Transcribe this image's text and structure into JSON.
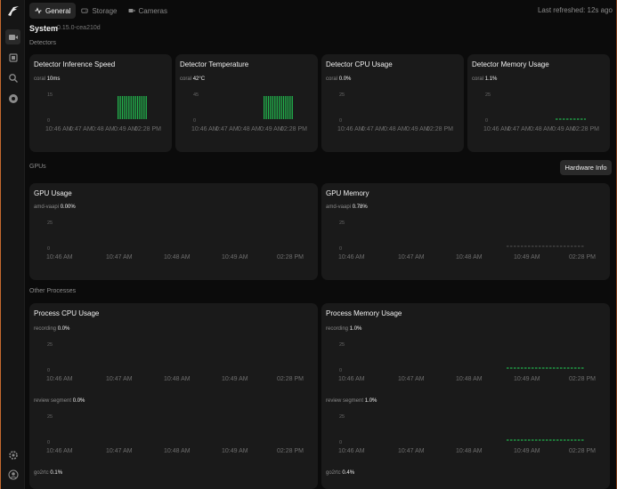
{
  "tabs": [
    {
      "label": "General",
      "icon": "activity-icon",
      "active": true
    },
    {
      "label": "Storage",
      "icon": "hard-drive-icon",
      "active": false
    },
    {
      "label": "Cameras",
      "icon": "camera-icon",
      "active": false
    }
  ],
  "last_refreshed": "Last refreshed: 12s ago",
  "system": {
    "title": "System",
    "version": "0.15.0-cea210d"
  },
  "sections": {
    "detectors": "Detectors",
    "gpus": "GPUs",
    "other": "Other Processes"
  },
  "hardware_info_button": "Hardware Info",
  "sidebar": {
    "items": [
      {
        "icon": "video-icon"
      },
      {
        "icon": "image-stack-icon"
      },
      {
        "icon": "search-icon"
      },
      {
        "icon": "activity-circle-icon"
      }
    ],
    "bottom": [
      {
        "icon": "gear-icon"
      },
      {
        "icon": "user-icon"
      }
    ]
  },
  "detector_cards": [
    {
      "title": "Detector Inference Speed",
      "series": "coral",
      "value": "10ms",
      "yticks": [
        "15",
        "0"
      ],
      "xticks": [
        "10:46 AM",
        "0:47 AM",
        "0:48 AM",
        "0:49 AM",
        "02:28 PM"
      ],
      "chart": "bars"
    },
    {
      "title": "Detector Temperature",
      "series": "coral",
      "value": "42°C",
      "yticks": [
        "45",
        "0"
      ],
      "xticks": [
        "10:46 AM",
        "0:47 AM",
        "0:48 AM",
        "0:49 AM",
        "02:28 PM"
      ],
      "chart": "bars"
    },
    {
      "title": "Detector CPU Usage",
      "series": "coral",
      "value": "0.0%",
      "yticks": [
        "25",
        "0"
      ],
      "xticks": [
        "10:46 AM",
        "0:47 AM",
        "0:48 AM",
        "0:49 AM",
        "02:28 PM"
      ],
      "chart": "none"
    },
    {
      "title": "Detector Memory Usage",
      "series": "coral",
      "value": "1.1%",
      "yticks": [
        "25",
        "0"
      ],
      "xticks": [
        "10:46 AM",
        "0:47 AM",
        "0:48 AM",
        "0:49 AM",
        "02:28 PM"
      ],
      "chart": "dashed"
    }
  ],
  "gpu_cards": [
    {
      "title": "GPU Usage",
      "series": "amd-vaapi",
      "value": "0.00%",
      "yticks": [
        "25",
        "0"
      ],
      "xticks": [
        "10:46 AM",
        "10:47 AM",
        "10:48 AM",
        "10:49 AM",
        "02:28 PM"
      ],
      "chart": "none"
    },
    {
      "title": "GPU Memory",
      "series": "amd-vaapi",
      "value": "0.78%",
      "yticks": [
        "25",
        "0"
      ],
      "xticks": [
        "10:46 AM",
        "10:47 AM",
        "10:48 AM",
        "10:49 AM",
        "02:28 PM"
      ],
      "chart": "dashed-faint"
    }
  ],
  "process_cards": [
    {
      "title": "Process CPU Usage",
      "rows": [
        {
          "series": "recording",
          "value": "0.0%",
          "yticks": [
            "25",
            "0"
          ],
          "xticks": [
            "10:46 AM",
            "10:47 AM",
            "10:48 AM",
            "10:49 AM",
            "02:28 PM"
          ],
          "chart": "none"
        },
        {
          "series": "review segment",
          "value": "0.0%",
          "yticks": [
            "25",
            "0"
          ],
          "xticks": [
            "10:46 AM",
            "10:47 AM",
            "10:48 AM",
            "10:49 AM",
            "02:28 PM"
          ],
          "chart": "none"
        },
        {
          "series": "go2rtc",
          "value": "0.1%"
        }
      ]
    },
    {
      "title": "Process Memory Usage",
      "rows": [
        {
          "series": "recording",
          "value": "1.0%",
          "yticks": [
            "25",
            "0"
          ],
          "xticks": [
            "10:46 AM",
            "10:47 AM",
            "10:48 AM",
            "10:49 AM",
            "02:28 PM"
          ],
          "chart": "dashed"
        },
        {
          "series": "review segment",
          "value": "1.0%",
          "yticks": [
            "25",
            "0"
          ],
          "xticks": [
            "10:46 AM",
            "10:47 AM",
            "10:48 AM",
            "10:49 AM",
            "02:28 PM"
          ],
          "chart": "dashed"
        },
        {
          "series": "go2rtc",
          "value": "0.4%"
        }
      ]
    }
  ],
  "colors": {
    "accent_green": "#22b14c",
    "card_bg": "#1a1a1a",
    "page_bg": "#0b0b0b"
  }
}
